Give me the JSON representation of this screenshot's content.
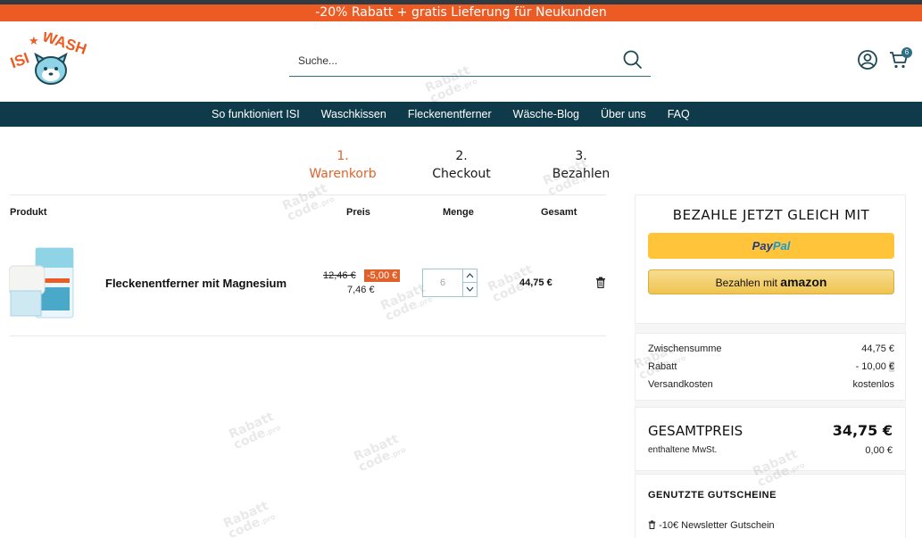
{
  "promo_banner": "-20% Rabatt + gratis Lieferung für Neukunden",
  "logo": {
    "text_left": "ISI",
    "text_right": "WASH"
  },
  "search": {
    "placeholder": "Suche..."
  },
  "cart": {
    "count": "6"
  },
  "nav": {
    "items": [
      {
        "label": "So funktioniert ISI"
      },
      {
        "label": "Waschkissen"
      },
      {
        "label": "Fleckenentferner"
      },
      {
        "label": "Wäsche-Blog"
      },
      {
        "label": "Über uns"
      },
      {
        "label": "FAQ"
      }
    ]
  },
  "steps": [
    {
      "num": "1.",
      "label": "Warenkorb",
      "active": true
    },
    {
      "num": "2.",
      "label": "Checkout",
      "active": false
    },
    {
      "num": "3.",
      "label": "Bezahlen",
      "active": false
    }
  ],
  "table": {
    "headers": {
      "product": "Produkt",
      "price": "Preis",
      "qty": "Menge",
      "total": "Gesamt"
    },
    "rows": [
      {
        "name": "Fleckenentferner mit Magnesium",
        "old_price": "12,46 €",
        "discount": "-5,00 €",
        "price": "7,46 €",
        "quantity": "6",
        "total": "44,75 €"
      }
    ]
  },
  "payment": {
    "title": "BEZAHLE JETZT GLEICH MIT",
    "paypal_part1": "Pay",
    "paypal_part2": "Pal",
    "amazon_prefix": "Bezahlen mit",
    "amazon_brand": "amazon"
  },
  "summary": {
    "subtotal_label": "Zwischensumme",
    "subtotal_value": "44,75 €",
    "discount_label": "Rabatt",
    "discount_value": "- 10,00",
    "discount_currency": "€",
    "shipping_label": "Versandkosten",
    "shipping_value": "kostenlos"
  },
  "total": {
    "label": "GESAMTPREIS",
    "value": "34,75 €",
    "vat_label": "enthaltene MwSt.",
    "vat_value": "0,00 €"
  },
  "coupons": {
    "title": "GENUTZTE GUTSCHEINE",
    "items": [
      {
        "label": "-10€ Newsletter Gutschein"
      }
    ]
  },
  "watermark": {
    "line1": "Rabatt",
    "line2": "code",
    "suffix": ".pro"
  },
  "colors": {
    "accent": "#e0622b",
    "promo": "#ec5b23",
    "nav_bg": "#0e3a4a",
    "teal": "#2f6f82"
  }
}
